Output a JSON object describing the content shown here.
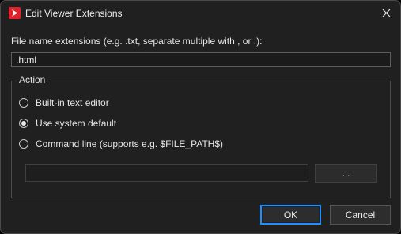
{
  "window": {
    "title": "Edit Viewer Extensions",
    "app_icon": "red-play-logo-icon",
    "close_icon": "close-icon"
  },
  "extensions": {
    "label": "File name extensions (e.g. .txt, separate multiple with , or ;):",
    "value": ".html"
  },
  "action": {
    "legend": "Action",
    "options": [
      {
        "label": "Built-in text editor",
        "checked": false
      },
      {
        "label": "Use system default",
        "checked": true
      },
      {
        "label": "Command line (supports e.g. $FILE_PATH$)",
        "checked": false
      }
    ],
    "command_value": "",
    "browse_label": "..."
  },
  "buttons": {
    "ok": "OK",
    "cancel": "Cancel"
  },
  "colors": {
    "background": "#202020",
    "accent_focus": "#1e90ff",
    "logo_red": "#e0202a"
  }
}
